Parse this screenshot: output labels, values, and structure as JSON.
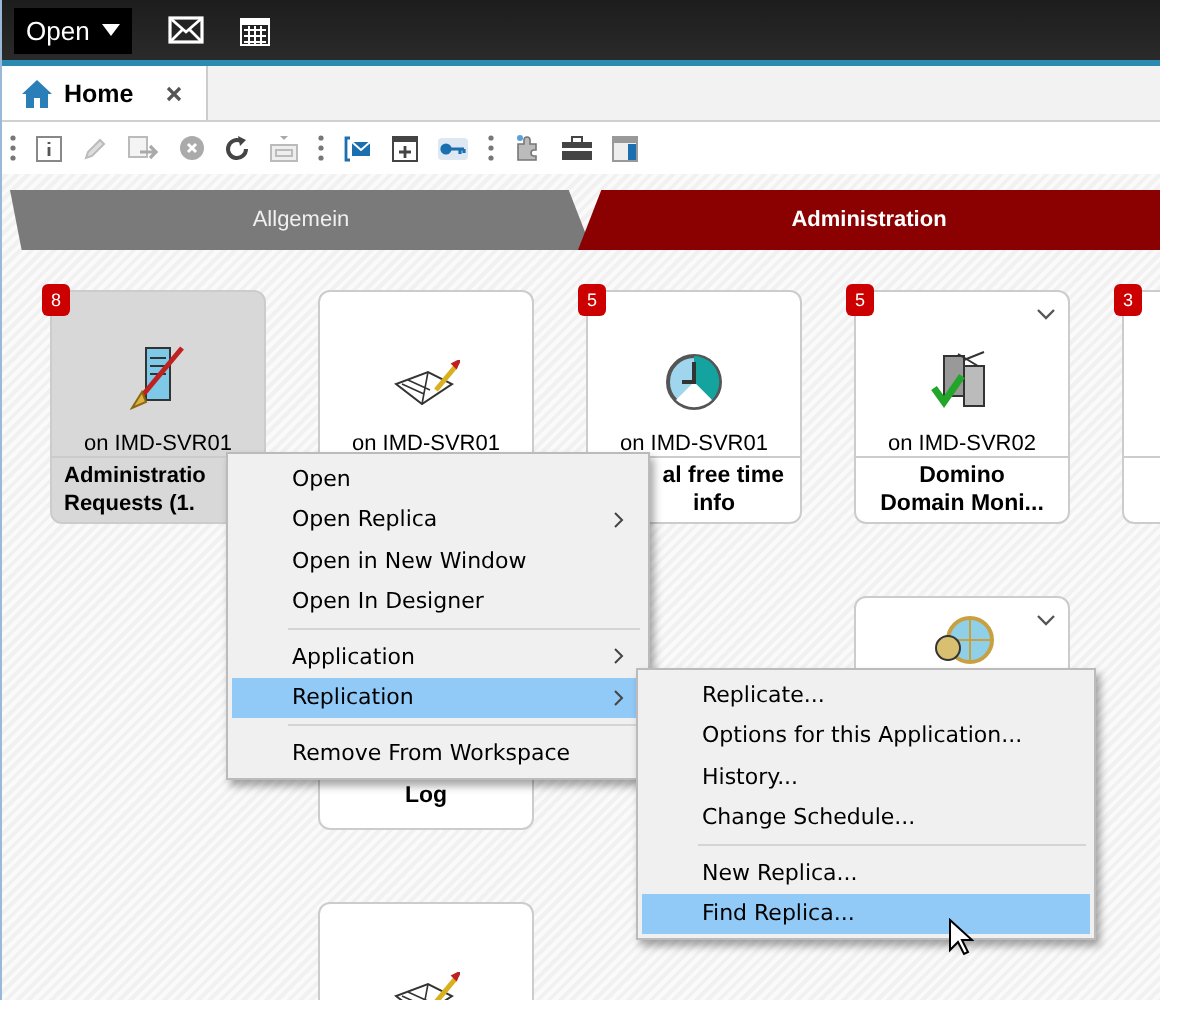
{
  "top_bar": {
    "open_label": "Open"
  },
  "tabs": [
    {
      "label": "Home",
      "selected": true
    }
  ],
  "categories": [
    {
      "label": "Allgemein",
      "selected": false
    },
    {
      "label": "Administration",
      "selected": true
    }
  ],
  "tile_rows": [
    [
      {
        "kind": "tile",
        "badge": "8",
        "server": "on IMD-SVR01",
        "title_lines": [
          "Administratio",
          "Requests (1."
        ],
        "selected": true,
        "menu": false
      },
      {
        "kind": "tile",
        "server": "on IMD-SVR01",
        "selected": false,
        "menu": false
      },
      {
        "kind": "tile",
        "badge": "5",
        "server": "on IMD-SVR01",
        "title_lines": [
          "al free time",
          "info"
        ],
        "selected": false,
        "menu": false
      },
      {
        "kind": "tile",
        "badge": "5",
        "server": "on IMD-SVR02",
        "title_lines": [
          "Domino",
          "Domain Moni..."
        ],
        "selected": false,
        "menu": true
      },
      {
        "kind": "tile",
        "badge": "3",
        "selected": false,
        "menu": false
      }
    ],
    [
      {
        "kind": "empty"
      },
      {
        "kind": "tile",
        "title_lines": [
          "Log"
        ],
        "selected": false,
        "menu": false
      },
      {
        "kind": "empty"
      },
      {
        "kind": "tile",
        "selected": false,
        "menu": true
      }
    ],
    [
      {
        "kind": "empty"
      },
      {
        "kind": "tile",
        "selected": false,
        "menu": false
      }
    ]
  ],
  "context_menu": {
    "groups": [
      [
        {
          "label": "Open",
          "submenu": false,
          "selected": false
        },
        {
          "label": "Open Replica",
          "submenu": true,
          "selected": false
        },
        {
          "label": "Open in New Window",
          "submenu": false,
          "selected": false
        },
        {
          "label": "Open In Designer",
          "submenu": false,
          "selected": false
        }
      ],
      [
        {
          "label": "Application",
          "submenu": true,
          "selected": false
        },
        {
          "label": "Replication",
          "submenu": true,
          "selected": true
        }
      ],
      [
        {
          "label": "Remove From Workspace",
          "submenu": false,
          "selected": false
        }
      ]
    ]
  },
  "submenu": {
    "groups": [
      [
        {
          "label": "Replicate...",
          "selected": false
        },
        {
          "label": "Options for this Application...",
          "selected": false
        },
        {
          "label": "History...",
          "selected": false
        },
        {
          "label": "Change Schedule...",
          "selected": false
        }
      ],
      [
        {
          "label": "New Replica...",
          "selected": false
        },
        {
          "label": "Find Replica...",
          "selected": true
        }
      ]
    ]
  }
}
